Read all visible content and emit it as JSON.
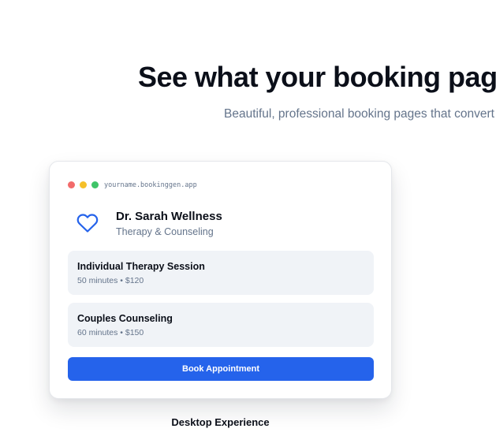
{
  "hero": {
    "title": "See what your booking page",
    "subtitle": "Beautiful, professional booking pages that convert"
  },
  "preview": {
    "url": "yourname.bookinggen.app",
    "provider": {
      "icon": "heart-icon",
      "name": "Dr. Sarah Wellness",
      "specialty": "Therapy & Counseling"
    },
    "services": [
      {
        "name": "Individual Therapy Session",
        "meta": "50 minutes • $120"
      },
      {
        "name": "Couples Counseling",
        "meta": "60 minutes • $150"
      }
    ],
    "book_label": "Book Appointment",
    "caption": "Desktop Experience"
  },
  "colors": {
    "accent": "#2563eb",
    "heading": "#0b0f19",
    "muted": "#64748b",
    "service_bg": "#f0f3f7",
    "traffic_red": "#f26b6b",
    "traffic_yellow": "#f5c02a",
    "traffic_green": "#3fc468"
  }
}
